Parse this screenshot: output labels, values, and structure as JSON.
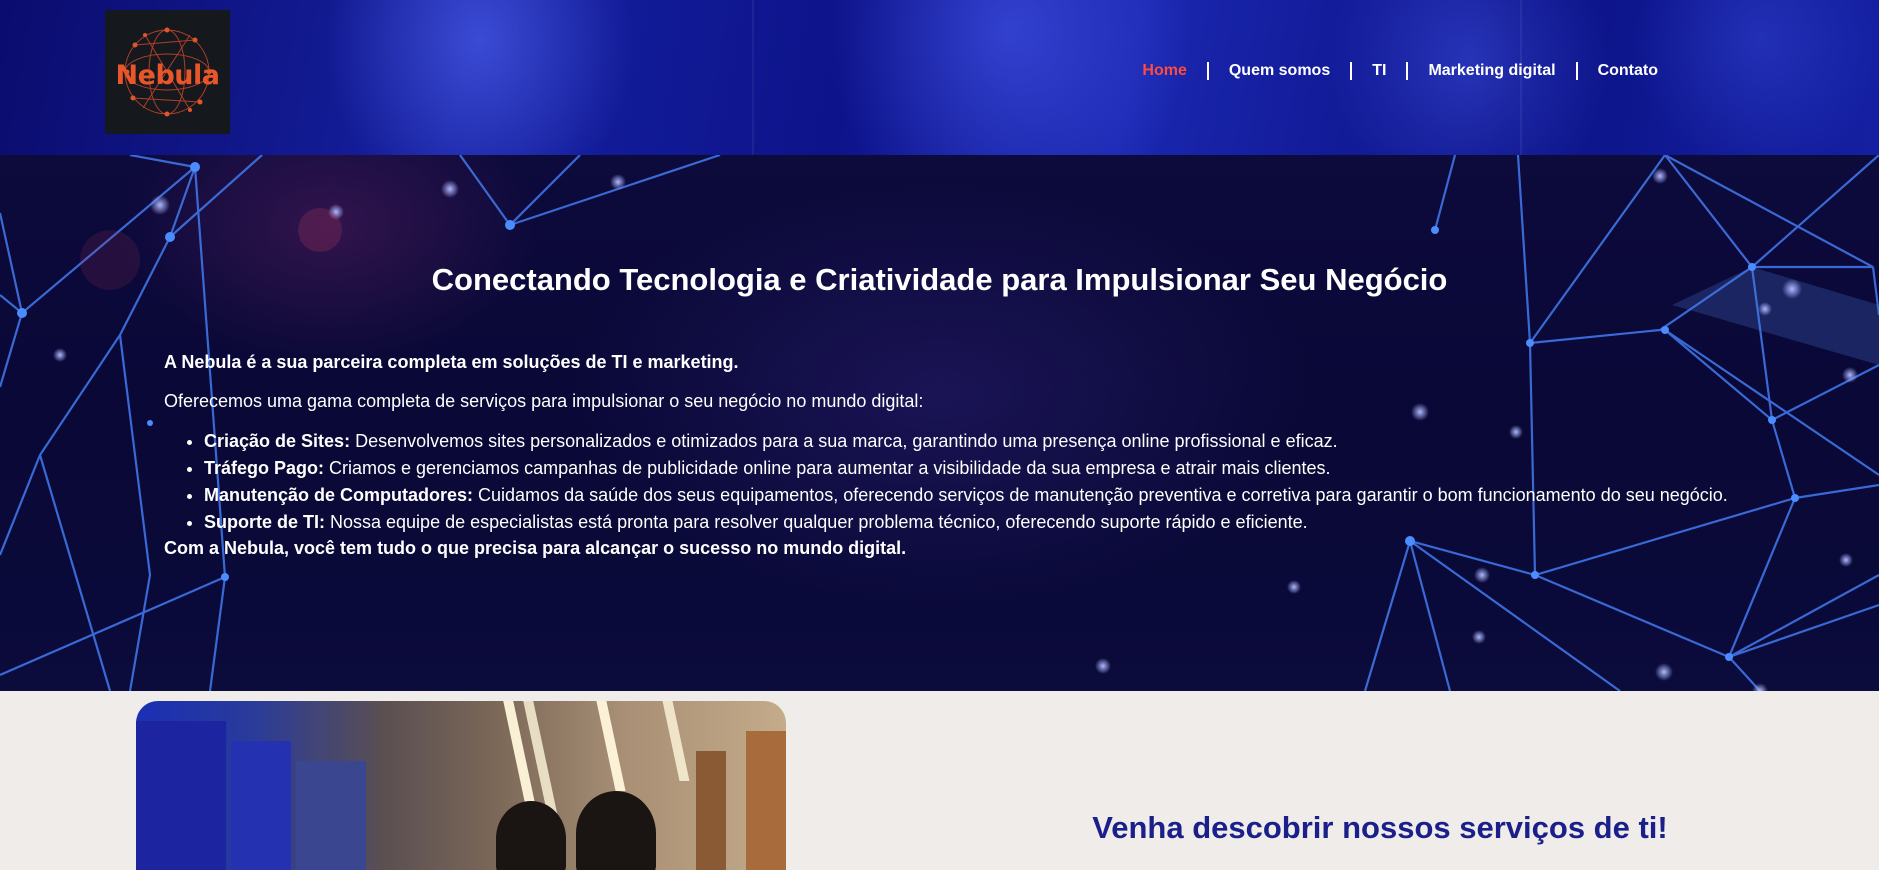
{
  "brand": {
    "logo_text": "Nebula"
  },
  "nav": {
    "items": [
      {
        "label": "Home",
        "active": true
      },
      {
        "label": "Quem somos",
        "active": false
      },
      {
        "label": "TI",
        "active": false
      },
      {
        "label": "Marketing digital",
        "active": false
      },
      {
        "label": "Contato",
        "active": false
      }
    ]
  },
  "hero": {
    "title": "Conectando Tecnologia e Criatividade para Impulsionar Seu Negócio",
    "intro_strong": "A Nebula é a sua parceira completa em soluções de TI e marketing.",
    "intro": "Oferecemos uma gama completa de serviços para impulsionar o seu negócio no mundo digital:",
    "services": [
      {
        "name": "Criação de Sites:",
        "desc": " Desenvolvemos sites personalizados e otimizados para a sua marca, garantindo uma presença online profissional e eficaz."
      },
      {
        "name": "Tráfego Pago:",
        "desc": " Criamos e gerenciamos campanhas de publicidade online para aumentar a visibilidade da sua empresa e atrair mais clientes."
      },
      {
        "name": "Manutenção de Computadores:",
        "desc": " Cuidamos da saúde dos seus equipamentos, oferecendo serviços de manutenção preventiva e corretiva para garantir o bom funcionamento do seu negócio."
      },
      {
        "name": "Suporte de TI:",
        "desc": " Nossa equipe de especialistas está pronta para resolver qualquer problema técnico, oferecendo suporte rápido e eficiente."
      }
    ],
    "closing": "Com a Nebula, você tem tudo o que precisa para alcançar o sucesso no mundo digital."
  },
  "services_section": {
    "title": "Venha descobrir nossos serviços de ti!"
  },
  "colors": {
    "nav_active": "#ff4b3e",
    "section_title": "#1a1f8a",
    "logo_text": "#e8562a",
    "page_bg": "#efecea"
  },
  "icons": [
    "nebula-network-logo-icon"
  ]
}
